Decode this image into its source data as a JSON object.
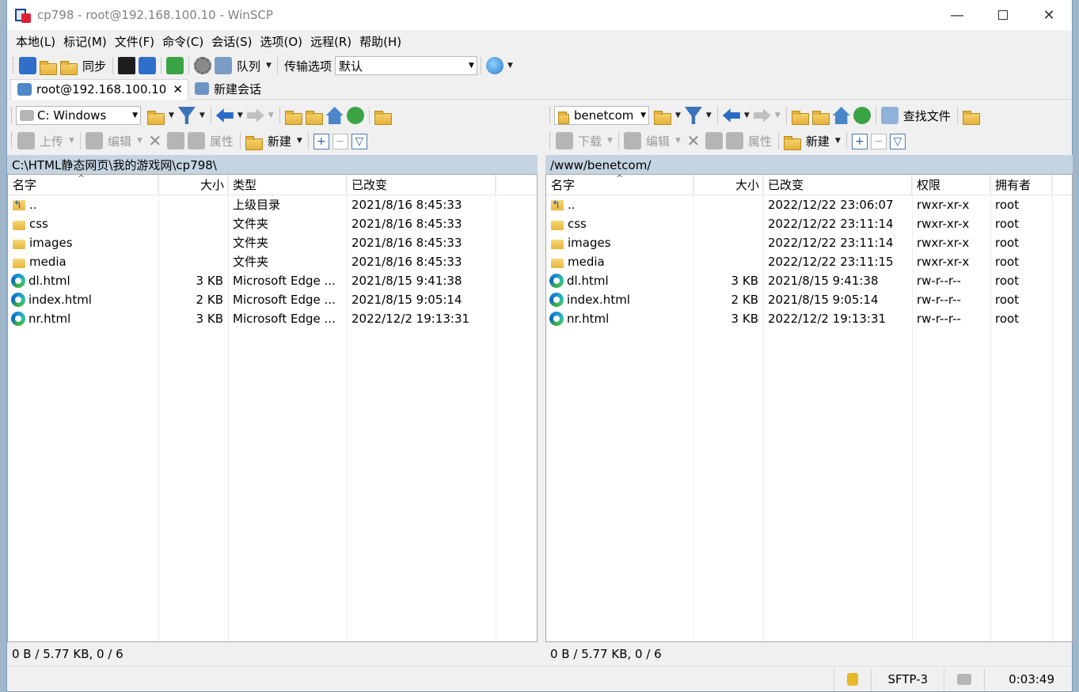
{
  "window": {
    "title": "cp798 - root@192.168.100.10 - WinSCP"
  },
  "menu": [
    "本地(L)",
    "标记(M)",
    "文件(F)",
    "命令(C)",
    "会话(S)",
    "选项(O)",
    "远程(R)",
    "帮助(H)"
  ],
  "toolbar": {
    "sync_label": "同步",
    "queue_label": "队列",
    "transfer_label": "传输选项",
    "transfer_value": "默认"
  },
  "tabs": [
    {
      "label": "root@192.168.100.10"
    },
    {
      "label": "新建会话"
    }
  ],
  "left": {
    "drive": "C: Windows",
    "upload_label": "上传",
    "edit_label": "编辑",
    "props_label": "属性",
    "new_label": "新建",
    "path": "C:\\HTML静态网页\\我的游戏网\\cp798\\",
    "columns": [
      "名字",
      "大小",
      "类型",
      "已改变"
    ],
    "files": [
      {
        "icon": "parent-folder-icon",
        "name": "..",
        "size": "",
        "type": "上级目录",
        "changed": "2021/8/16  8:45:33"
      },
      {
        "icon": "folder-icon",
        "name": "css",
        "size": "",
        "type": "文件夹",
        "changed": "2021/8/16  8:45:33"
      },
      {
        "icon": "folder-icon",
        "name": "images",
        "size": "",
        "type": "文件夹",
        "changed": "2021/8/16  8:45:33"
      },
      {
        "icon": "folder-icon",
        "name": "media",
        "size": "",
        "type": "文件夹",
        "changed": "2021/8/16  8:45:33"
      },
      {
        "icon": "edge-file-icon",
        "name": "dl.html",
        "size": "3 KB",
        "type": "Microsoft Edge ...",
        "changed": "2021/8/15  9:41:38"
      },
      {
        "icon": "edge-file-icon",
        "name": "index.html",
        "size": "2 KB",
        "type": "Microsoft Edge ...",
        "changed": "2021/8/15  9:05:14"
      },
      {
        "icon": "edge-file-icon",
        "name": "nr.html",
        "size": "3 KB",
        "type": "Microsoft Edge ...",
        "changed": "2022/12/2  19:13:31"
      }
    ],
    "status": "0 B / 5.77 KB,   0 / 6"
  },
  "right": {
    "dir": "benetcom",
    "find_label": "查找文件",
    "download_label": "下载",
    "edit_label": "编辑",
    "props_label": "属性",
    "new_label": "新建",
    "path": "/www/benetcom/",
    "columns": [
      "名字",
      "大小",
      "已改变",
      "权限",
      "拥有者"
    ],
    "files": [
      {
        "icon": "parent-folder-icon",
        "name": "..",
        "size": "",
        "changed": "2022/12/22 23:06:07",
        "rights": "rwxr-xr-x",
        "owner": "root"
      },
      {
        "icon": "folder-icon",
        "name": "css",
        "size": "",
        "changed": "2022/12/22 23:11:14",
        "rights": "rwxr-xr-x",
        "owner": "root"
      },
      {
        "icon": "folder-icon",
        "name": "images",
        "size": "",
        "changed": "2022/12/22 23:11:14",
        "rights": "rwxr-xr-x",
        "owner": "root"
      },
      {
        "icon": "folder-icon",
        "name": "media",
        "size": "",
        "changed": "2022/12/22 23:11:15",
        "rights": "rwxr-xr-x",
        "owner": "root"
      },
      {
        "icon": "edge-file-icon",
        "name": "dl.html",
        "size": "3 KB",
        "changed": "2021/8/15 9:41:38",
        "rights": "rw-r--r--",
        "owner": "root"
      },
      {
        "icon": "edge-file-icon",
        "name": "index.html",
        "size": "2 KB",
        "changed": "2021/8/15 9:05:14",
        "rights": "rw-r--r--",
        "owner": "root"
      },
      {
        "icon": "edge-file-icon",
        "name": "nr.html",
        "size": "3 KB",
        "changed": "2022/12/2 19:13:31",
        "rights": "rw-r--r--",
        "owner": "root"
      }
    ],
    "status": "0 B / 5.77 KB,   0 / 6"
  },
  "statusbar": {
    "protocol": "SFTP-3",
    "elapsed": "0:03:49"
  }
}
